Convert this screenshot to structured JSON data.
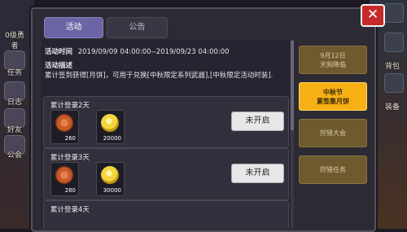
{
  "background": {
    "left_labels": [
      "任务",
      "日志",
      "好友",
      "公会"
    ],
    "right_labels": [
      "背包",
      "装备"
    ],
    "top_left_badge": "0级勇者"
  },
  "tabs": [
    {
      "label": "活动",
      "active": true
    },
    {
      "label": "公告",
      "active": false
    }
  ],
  "event": {
    "time_label": "活动时间",
    "time_value": "2019/09/09 04:00:00--2019/09/23 04:00:00",
    "desc_label": "活动描述",
    "desc_text": "累计签到获得[月饼]，可用于兑换[中秋限定系列武器],[中秋限定活动时装]."
  },
  "rewards": [
    {
      "title": "累计登录2天",
      "items": [
        {
          "icon": "mooncake-icon",
          "qty": "260"
        },
        {
          "icon": "gold-coin-icon",
          "qty": "20000"
        }
      ],
      "button": "未开启"
    },
    {
      "title": "累计登录3天",
      "items": [
        {
          "icon": "mooncake-icon",
          "qty": "280"
        },
        {
          "icon": "gold-coin-icon",
          "qty": "30000"
        }
      ],
      "button": "未开启"
    },
    {
      "title": "累计登录4天",
      "items": [],
      "button": ""
    }
  ],
  "side_events": [
    {
      "line1": "9月12日",
      "line2": "天狗降临",
      "active": false
    },
    {
      "line1": "中秋节",
      "line2": "累签集月饼",
      "active": true
    },
    {
      "line1": "狩猎大会",
      "line2": "",
      "active": false
    },
    {
      "line1": "狩猎任务",
      "line2": "",
      "active": false
    }
  ],
  "close_label": "✕",
  "colors": {
    "tab_active": "#6c65a5",
    "event_active": "#f6b015",
    "event_dim": "#6e5a2e",
    "close": "#c42a2a"
  }
}
